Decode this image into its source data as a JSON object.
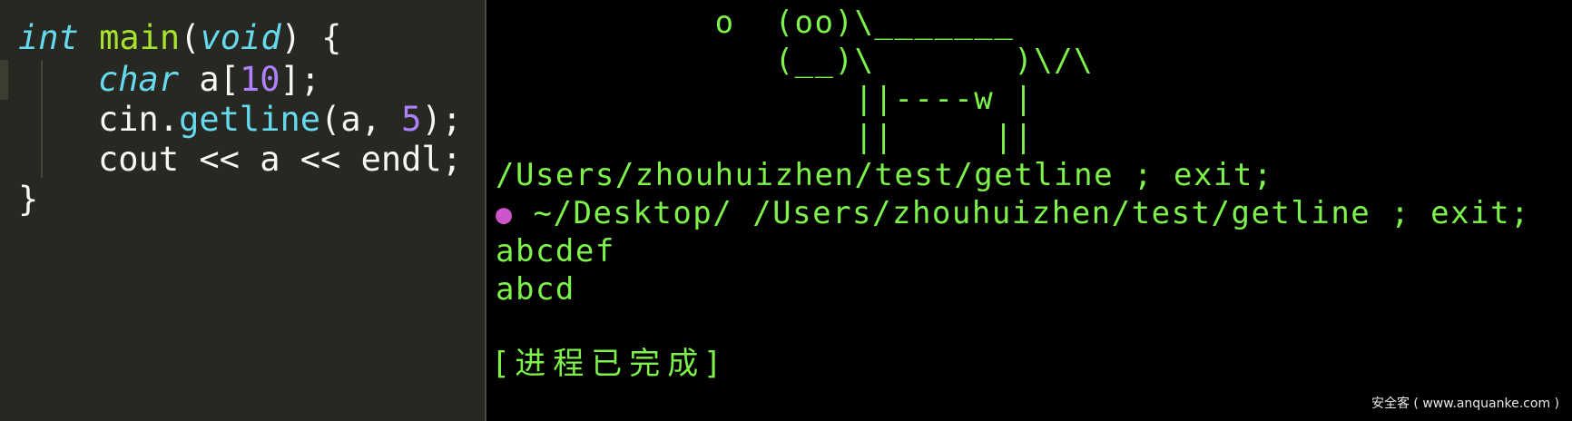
{
  "editor": {
    "line1": {
      "kw": "int",
      "fn": "main",
      "open": "(",
      "arg": "void",
      "close": ") {"
    },
    "line2": {
      "kw": "char",
      "rest1": " a[",
      "num": "10",
      "rest2": "];"
    },
    "line3": {
      "obj": "cin.",
      "method": "getline",
      "open": "(a, ",
      "num": "5",
      "close": ");"
    },
    "line4": {
      "text": "cout << a << endl;"
    },
    "line5": {
      "text": "}"
    }
  },
  "terminal": {
    "cow": [
      "           o  (oo)\\_______",
      "              (__)\\       )\\/\\",
      "                  ||----w |",
      "                  ||     ||"
    ],
    "command_line": "/Users/zhouhuizhen/test/getline ; exit;",
    "prompt_icon": "apple-icon",
    "prompt_text": " ~/Desktop/ /Users/zhouhuizhen/test/getline ; exit;",
    "input_line": "abcdef",
    "output_line": "abcd",
    "status": "[进程已完成]"
  },
  "watermark": "安全客 ( www.anquanke.com )",
  "colors": {
    "editor_bg": "#272822",
    "terminal_bg": "#000000",
    "terminal_text": "#7cf24a",
    "keyword": "#66d9ef",
    "function": "#a6e22e",
    "number": "#ae81ff"
  }
}
